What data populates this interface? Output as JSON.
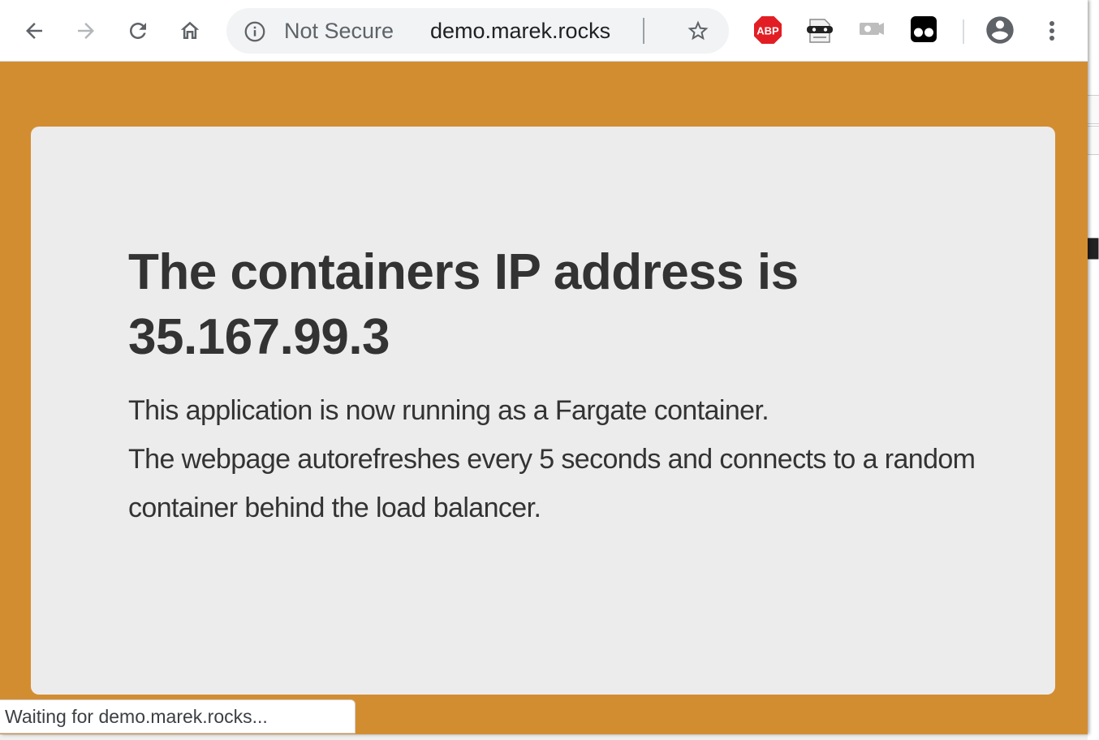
{
  "colors": {
    "page_background": "#d38d31",
    "card_background": "#ececec",
    "text": "#333333",
    "abp_red": "#e21e24"
  },
  "browser": {
    "nav": {
      "back_icon": "arrow-left-icon",
      "forward_icon": "arrow-right-icon",
      "reload_icon": "reload-icon",
      "home_icon": "home-icon"
    },
    "omnibox": {
      "security_icon": "info-circle-icon",
      "security_label": "Not Secure",
      "url": "demo.marek.rocks",
      "bookmark_icon": "star-outline-icon"
    },
    "extensions": [
      {
        "name": "adblock-plus",
        "label": "ABP"
      },
      {
        "name": "incognito-mask"
      },
      {
        "name": "camera"
      },
      {
        "name": "tampermonkey"
      }
    ],
    "profile_icon": "account-circle-icon",
    "menu_icon": "three-dot-menu-icon",
    "status": "Waiting for demo.marek.rocks..."
  },
  "page": {
    "heading": "The containers IP address is 35.167.99.3",
    "paragraph_1": "This application is now running as a Fargate container.",
    "paragraph_2": "The webpage autorefreshes every 5 seconds and connects to a random container behind the load balancer."
  }
}
